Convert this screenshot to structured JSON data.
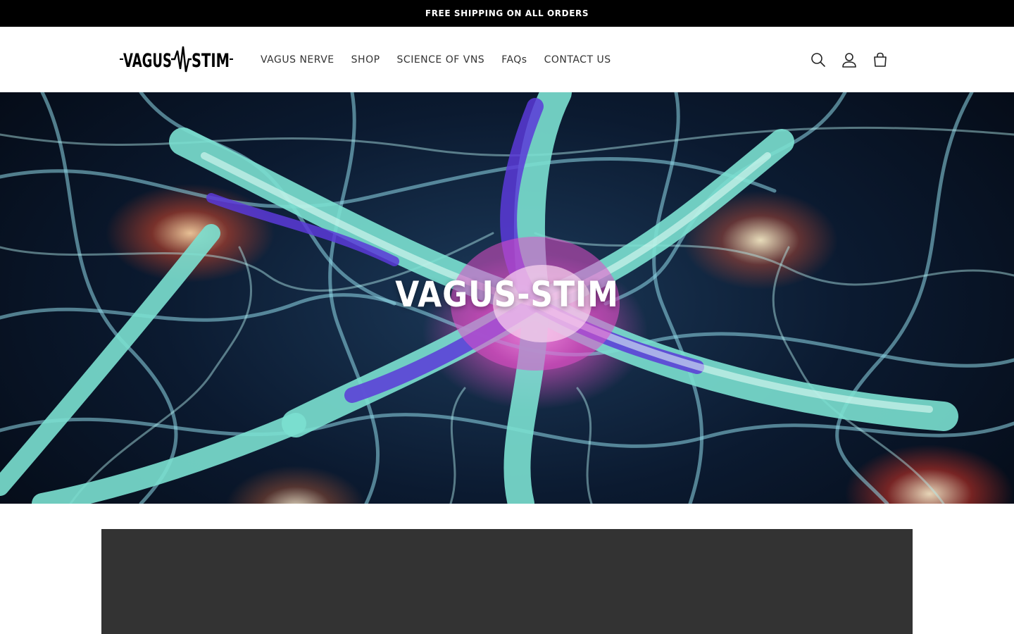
{
  "announcement": {
    "text": "FREE SHIPPING ON ALL ORDERS"
  },
  "header": {
    "logo": {
      "text_left": "VAGUS",
      "text_right": "STIM"
    },
    "nav": [
      {
        "label": "VAGUS NERVE"
      },
      {
        "label": "SHOP"
      },
      {
        "label": "SCIENCE OF VNS"
      },
      {
        "label": "FAQs"
      },
      {
        "label": "CONTACT US"
      }
    ],
    "icons": {
      "search": "search-icon",
      "account": "account-icon",
      "cart": "cart-icon"
    }
  },
  "hero": {
    "title": "VAGUS-STIM"
  },
  "colors": {
    "announcement_bg": "#000000",
    "nav_text": "#333333",
    "dark_section": "#333333"
  }
}
